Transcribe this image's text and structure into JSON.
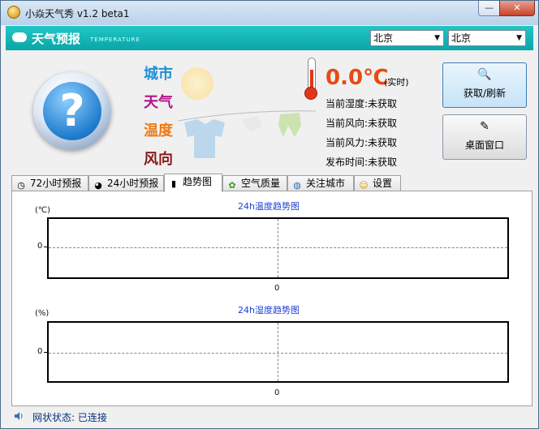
{
  "window": {
    "title": "小焱天气秀 v1.2 beta1",
    "minimize_label": "—",
    "close_label": "✕"
  },
  "header": {
    "title": "天气预报",
    "subtitle": "TEMPERATURE",
    "city_select_1": "北京",
    "city_select_2": "北京"
  },
  "weather": {
    "icon": "unknown-weather-icon",
    "labels": {
      "city": "城市",
      "weather": "天气",
      "temperature": "温度",
      "wind": "风向"
    },
    "label_colors": {
      "city": "#1c8fd6",
      "weather": "#b3138a",
      "temperature": "#f07a10",
      "wind": "#8a1a1a"
    },
    "temperature_value": "0.0℃",
    "temperature_note": "(实时)",
    "humidity": "当前湿度:未获取",
    "wind_direction": "当前风向:未获取",
    "wind_force": "当前风力:未获取",
    "publish_time": "发布时间:未获取"
  },
  "buttons": {
    "fetch_refresh": "获取/刷新",
    "desktop_window": "桌面窗口"
  },
  "tabs": [
    {
      "label": "72小时预报",
      "icon": "clock-icon"
    },
    {
      "label": "24小时预报",
      "icon": "pie-chart-icon"
    },
    {
      "label": "趋势图",
      "icon": "bar-chart-icon",
      "active": true
    },
    {
      "label": "空气质量",
      "icon": "clover-icon"
    },
    {
      "label": "关注城市",
      "icon": "globe-icon"
    },
    {
      "label": "设置",
      "icon": "smiley-icon"
    }
  ],
  "chart_data": [
    {
      "type": "line",
      "title": "24h温度趋势图",
      "ylabel": "(℃)",
      "xlabel": "",
      "y_ticks": [
        "0"
      ],
      "x_ticks": [
        "0"
      ],
      "series": [],
      "grid": true
    },
    {
      "type": "line",
      "title": "24h湿度趋势图",
      "ylabel": "(%)",
      "xlabel": "",
      "y_ticks": [
        "0"
      ],
      "x_ticks": [
        "0"
      ],
      "series": [],
      "grid": true
    }
  ],
  "status": {
    "text": "网状状态: 已连接",
    "icon": "speaker-icon"
  }
}
